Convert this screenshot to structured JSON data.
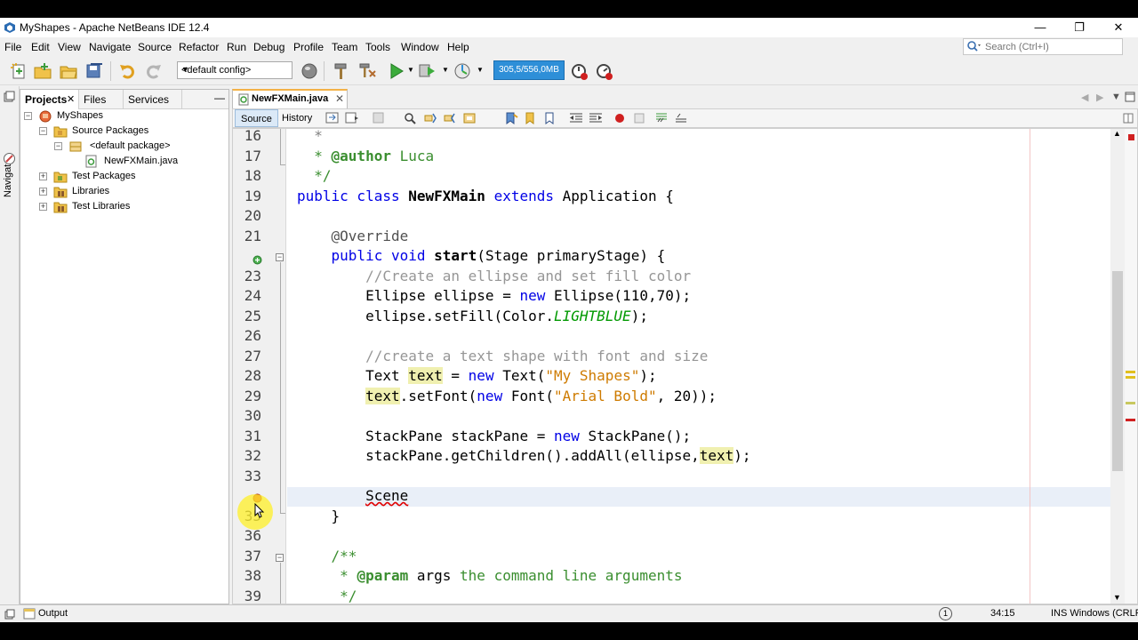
{
  "window": {
    "title": "MyShapes - Apache NetBeans IDE 12.4",
    "minimize": "—",
    "restore": "❐",
    "close": "✕"
  },
  "menu": [
    "File",
    "Edit",
    "View",
    "Navigate",
    "Source",
    "Refactor",
    "Run",
    "Debug",
    "Profile",
    "Team",
    "Tools",
    "Window",
    "Help"
  ],
  "search": {
    "placeholder": "Search (Ctrl+I)"
  },
  "toolbar": {
    "config": "<default config>",
    "memory": "305,5/556,0MB"
  },
  "left_panel": {
    "navigator_label": "Navigator",
    "tabs": [
      "Projects",
      "Files",
      "Services"
    ],
    "minimize": "—",
    "tree": [
      {
        "label": "MyShapes",
        "level": 0,
        "expanded": true,
        "icon": "project-icon"
      },
      {
        "label": "Source Packages",
        "level": 1,
        "expanded": true,
        "icon": "package-folder-icon"
      },
      {
        "label": "<default package>",
        "level": 2,
        "expanded": true,
        "icon": "package-icon"
      },
      {
        "label": "NewFXMain.java",
        "level": 3,
        "expanded": null,
        "icon": "java-file-icon"
      },
      {
        "label": "Test Packages",
        "level": 1,
        "expanded": false,
        "icon": "package-folder-icon"
      },
      {
        "label": "Libraries",
        "level": 1,
        "expanded": false,
        "icon": "library-folder-icon"
      },
      {
        "label": "Test Libraries",
        "level": 1,
        "expanded": false,
        "icon": "library-folder-icon"
      }
    ]
  },
  "editor": {
    "file_tab": "NewFXMain.java",
    "tab_close": "✕",
    "source_btn": "Source",
    "history_btn": "History",
    "line_numbers": [
      "16",
      "17",
      "18",
      "19",
      "20",
      "21",
      "",
      "23",
      "24",
      "25",
      "26",
      "27",
      "28",
      "29",
      "30",
      "31",
      "32",
      "33",
      "",
      "35",
      "36",
      "37",
      "38",
      "39"
    ]
  },
  "status": {
    "output": "Output",
    "position": "34:15",
    "mode": "INS Windows (CRLF)",
    "notifications": "1"
  },
  "colors": {
    "keyword": "#0000e6",
    "string": "#ce7b00",
    "comment": "#969696",
    "javadoc": "#3a8e2f",
    "memory_bar": "#2e8fd8"
  }
}
